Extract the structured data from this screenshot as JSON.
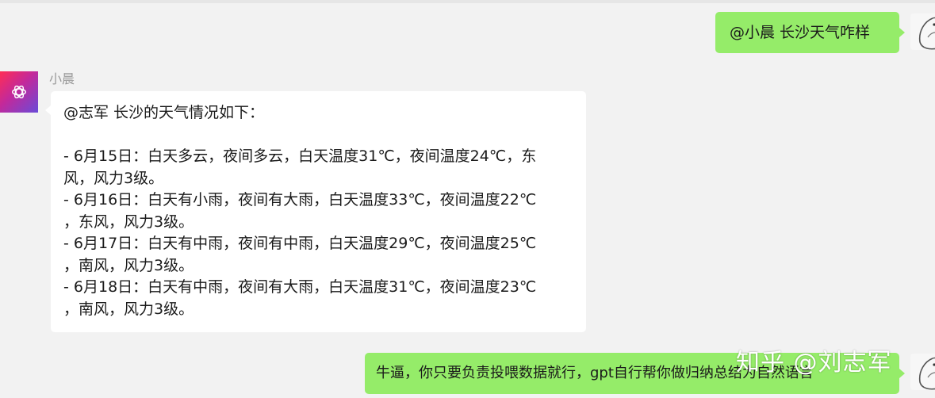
{
  "messages": [
    {
      "side": "right",
      "text": "@小晨  长沙天气咋样"
    },
    {
      "side": "left",
      "sender": "小晨",
      "lines": [
        "@志军 长沙的天气情况如下：",
        "",
        "- 6月15日：白天多云，夜间多云，白天温度31℃，夜间温度24℃，东",
        "风，风力3级。",
        "- 6月16日：白天有小雨，夜间有大雨，白天温度33℃，夜间温度22℃",
        "，东风，风力3级。",
        "- 6月17日：白天有中雨，夜间有中雨，白天温度29℃，夜间温度25℃",
        "，南风，风力3级。",
        "- 6月18日：白天有中雨，夜间有大雨，白天温度31℃，夜间温度23℃",
        "，南风，风力3级。"
      ]
    },
    {
      "side": "right",
      "text": "牛逼，你只要负责投喂数据就行，gpt自行帮你做归纳总结为自然语言"
    }
  ],
  "watermark": "知乎 @刘志军",
  "colors": {
    "background": "#f2f2f2",
    "my_bubble": "#95ec69",
    "bot_bubble": "#ffffff",
    "sender_name": "#9a9a9a"
  },
  "icons": {
    "bot_avatar": "openai-logo-icon",
    "my_avatar": "bird-sketch-icon"
  }
}
